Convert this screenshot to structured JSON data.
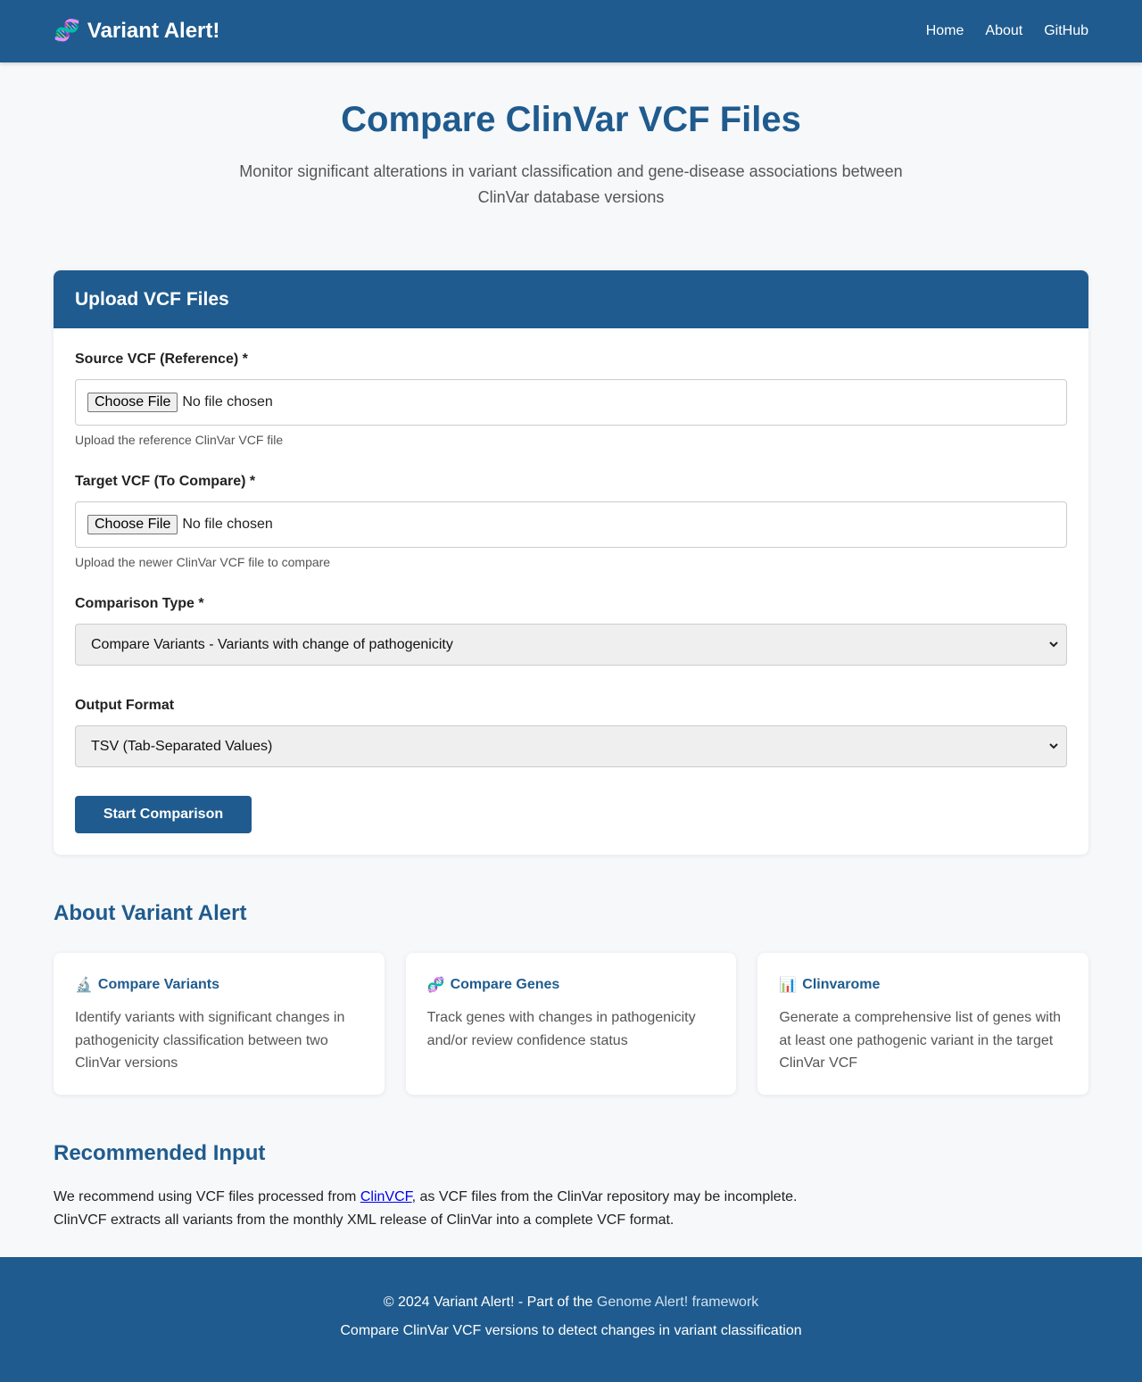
{
  "nav": {
    "brand_icon": "🧬",
    "brand": "Variant Alert!",
    "links": [
      "Home",
      "About",
      "GitHub"
    ]
  },
  "hero": {
    "title": "Compare ClinVar VCF Files",
    "subtitle": "Monitor significant alterations in variant classification and gene-disease associations between ClinVar database versions"
  },
  "upload": {
    "header": "Upload VCF Files",
    "source": {
      "label": "Source VCF (Reference) *",
      "button": "Choose File",
      "status": "No file chosen",
      "hint": "Upload the reference ClinVar VCF file"
    },
    "target": {
      "label": "Target VCF (To Compare) *",
      "button": "Choose File",
      "status": "No file chosen",
      "hint": "Upload the newer ClinVar VCF file to compare"
    },
    "comparison": {
      "label": "Comparison Type *",
      "selected": "Compare Variants - Variants with change of pathogenicity"
    },
    "output": {
      "label": "Output Format",
      "selected": "TSV (Tab-Separated Values)"
    },
    "submit": "Start Comparison"
  },
  "about": {
    "title": "About Variant Alert",
    "features": [
      {
        "icon": "🔬",
        "title": "Compare Variants",
        "text": "Identify variants with significant changes in pathogenicity classification between two ClinVar versions"
      },
      {
        "icon": "🧬",
        "title": "Compare Genes",
        "text": "Track genes with changes in pathogenicity and/or review confidence status"
      },
      {
        "icon": "📊",
        "title": "Clinvarome",
        "text": "Generate a comprehensive list of genes with at least one pathogenic variant in the target ClinVar VCF"
      }
    ]
  },
  "recommended": {
    "title": "Recommended Input",
    "pre": "We recommend using VCF files processed from ",
    "link": "ClinVCF",
    "post": ", as VCF files from the ClinVar repository may be incomplete.",
    "line2": "ClinVCF extracts all variants from the monthly XML release of ClinVar into a complete VCF format."
  },
  "footer": {
    "line1_pre": "© 2024 Variant Alert! - Part of the ",
    "line1_link": "Genome Alert! framework",
    "line2": "Compare ClinVar VCF versions to detect changes in variant classification"
  }
}
